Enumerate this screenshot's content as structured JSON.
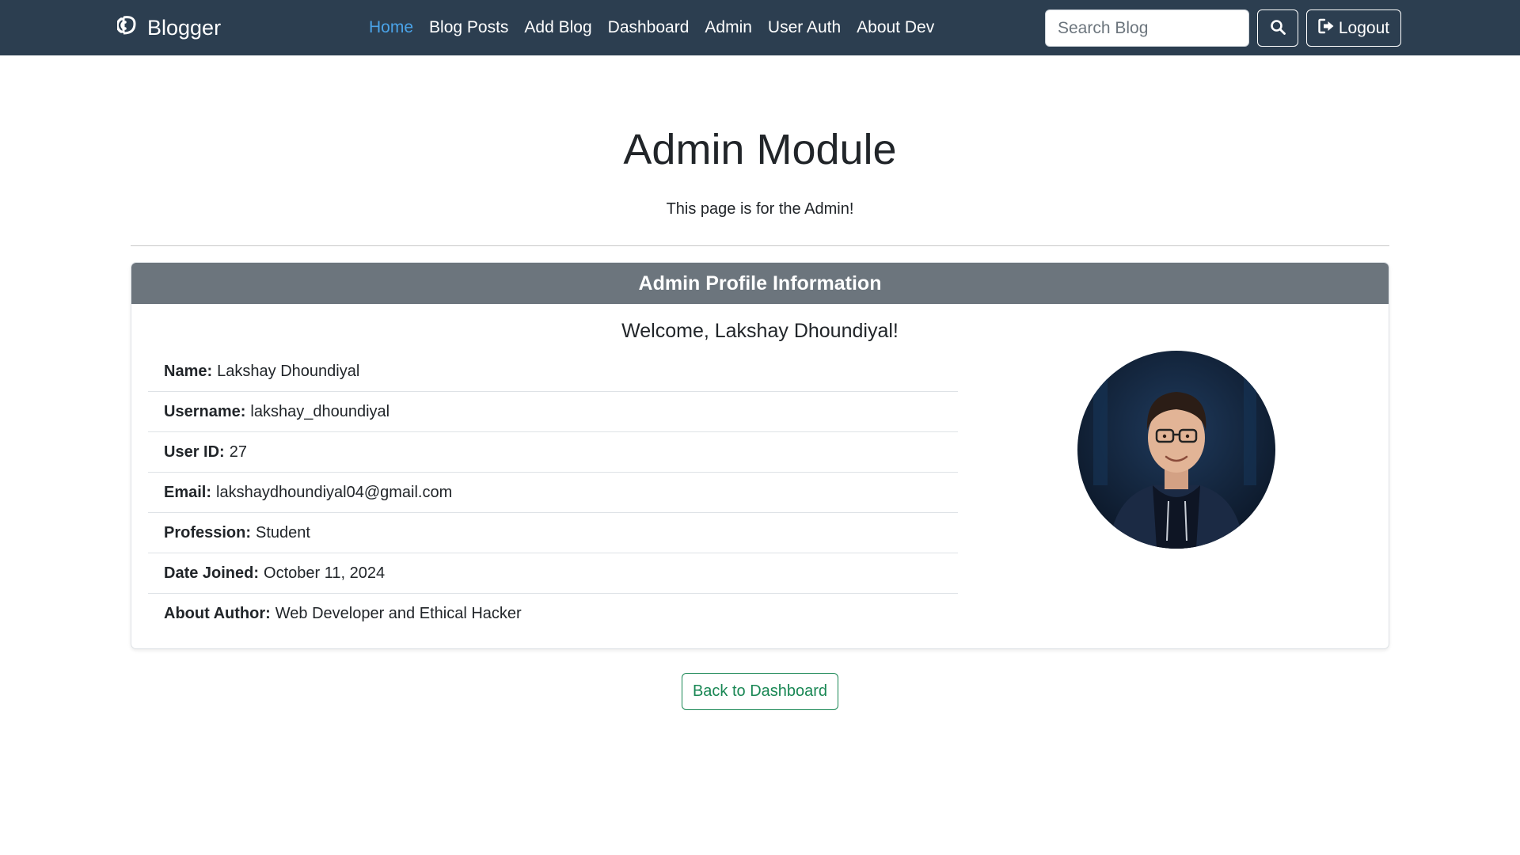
{
  "colors": {
    "navbar_bg": "#2c3e50",
    "nav_active": "#4aa3e8",
    "card_header_bg": "#6c757d",
    "success": "#198754"
  },
  "navbar": {
    "brand": "Blogger",
    "brand_icon": "blogger-logo-icon",
    "links": [
      {
        "label": "Home",
        "active": true
      },
      {
        "label": "Blog Posts"
      },
      {
        "label": "Add Blog"
      },
      {
        "label": "Dashboard"
      },
      {
        "label": "Admin"
      },
      {
        "label": "User Auth"
      },
      {
        "label": "About Dev"
      }
    ],
    "search_placeholder": "Search Blog",
    "search_icon": "search-icon",
    "logout_label": "Logout",
    "logout_icon": "sign-out-icon"
  },
  "main": {
    "title": "Admin Module",
    "lead": "This page is for the Admin!"
  },
  "card": {
    "header": "Admin Profile Information",
    "welcome": "Welcome, Lakshay Dhoundiyal!",
    "fields": [
      {
        "label": "Name:",
        "value": "Lakshay Dhoundiyal"
      },
      {
        "label": "Username:",
        "value": "lakshay_dhoundiyal"
      },
      {
        "label": "User ID:",
        "value": "27"
      },
      {
        "label": "Email:",
        "value": "lakshaydhoundiyal04@gmail.com"
      },
      {
        "label": "Profession:",
        "value": "Student"
      },
      {
        "label": "Date Joined:",
        "value": "October 11, 2024"
      },
      {
        "label": "About Author:",
        "value": "Web Developer and Ethical Hacker"
      }
    ]
  },
  "back_button": "Back to Dashboard"
}
